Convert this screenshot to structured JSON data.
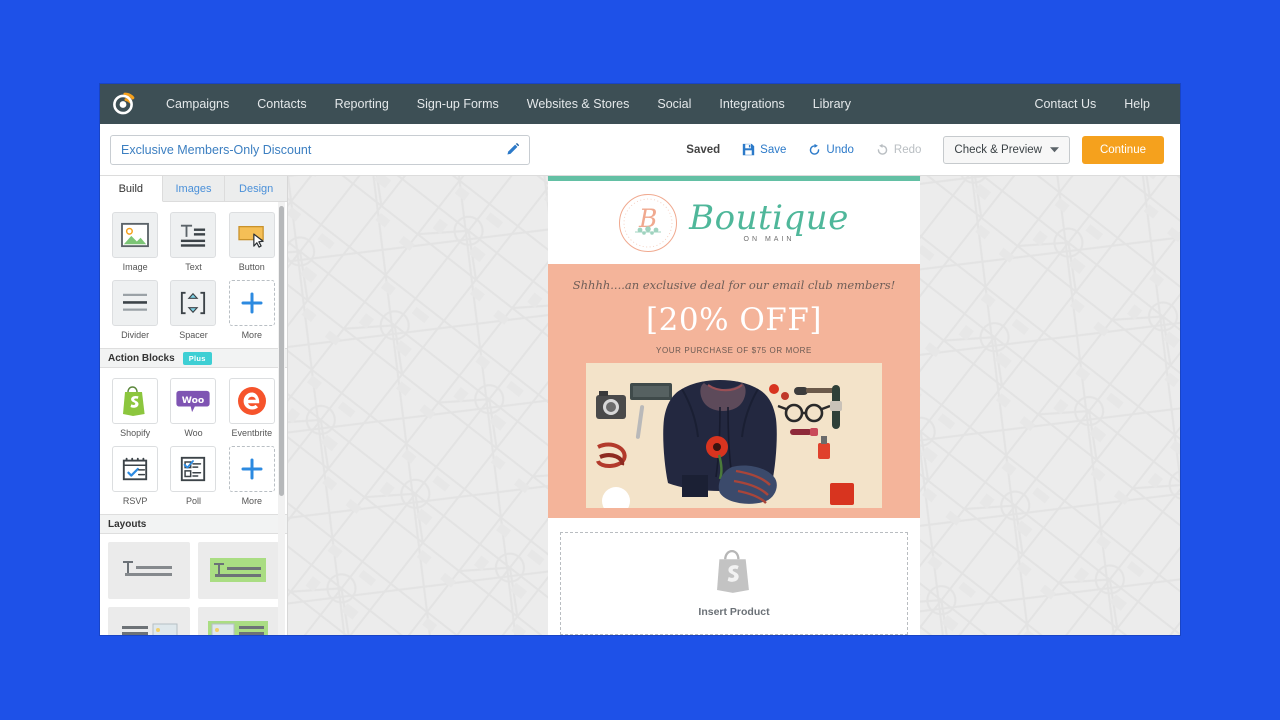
{
  "page": {
    "background_color": "#1e51e8",
    "app_bg": "#ffffff"
  },
  "top_nav": {
    "brand_icon": "constant-contact-logo-icon",
    "brand_colors": {
      "ring": "#ffffff",
      "swoosh": "#f5a11d"
    },
    "background": "#3d4f55",
    "links": [
      {
        "label": "Campaigns"
      },
      {
        "label": "Contacts"
      },
      {
        "label": "Reporting"
      },
      {
        "label": "Sign-up Forms"
      },
      {
        "label": "Websites & Stores"
      },
      {
        "label": "Social"
      },
      {
        "label": "Integrations"
      },
      {
        "label": "Library"
      }
    ],
    "right_links": [
      {
        "label": "Contact Us"
      },
      {
        "label": "Help"
      }
    ]
  },
  "toolbar": {
    "campaign_title": "Exclusive Members-Only Discount",
    "campaign_title_placeholder": "Email name",
    "edit_icon": "pencil-icon",
    "status": "Saved",
    "save_label": "Save",
    "undo_label": "Undo",
    "redo_label": "Redo",
    "check_preview_label": "Check & Preview",
    "continue_label": "Continue",
    "accent_color": "#f5a11d",
    "link_color": "#2c7ac9"
  },
  "sidebar": {
    "tabs": [
      {
        "label": "Build",
        "active": true
      },
      {
        "label": "Images",
        "active": false
      },
      {
        "label": "Design",
        "active": false
      }
    ],
    "build_blocks": [
      {
        "label": "Image",
        "icon": "image-icon"
      },
      {
        "label": "Text",
        "icon": "text-icon"
      },
      {
        "label": "Button",
        "icon": "button-icon"
      },
      {
        "label": "Divider",
        "icon": "divider-icon"
      },
      {
        "label": "Spacer",
        "icon": "spacer-icon"
      },
      {
        "label": "More",
        "icon": "plus-icon"
      }
    ],
    "action_blocks_section": {
      "title": "Action Blocks",
      "badge": "Plus",
      "badge_color": "#3ecfd4"
    },
    "action_blocks": [
      {
        "label": "Shopify",
        "icon": "shopify-icon"
      },
      {
        "label": "Woo",
        "icon": "woocommerce-icon"
      },
      {
        "label": "Eventbrite",
        "icon": "eventbrite-icon"
      },
      {
        "label": "RSVP",
        "icon": "rsvp-calendar-icon"
      },
      {
        "label": "Poll",
        "icon": "poll-icon"
      },
      {
        "label": "More",
        "icon": "plus-icon"
      }
    ],
    "layouts_section": {
      "title": "Layouts"
    },
    "layouts": [
      {
        "name": "text-layout-plain"
      },
      {
        "name": "text-layout-highlighted"
      },
      {
        "name": "text-image-layout-plain"
      },
      {
        "name": "text-image-layout-highlighted"
      }
    ]
  },
  "email": {
    "accent_bar_color": "#63c0a4",
    "promo_bg_color": "#f4b49a",
    "logo": {
      "monogram": "B",
      "wordmark": "Boutique",
      "tagline": "ON MAIN"
    },
    "promo": {
      "teaser": "Shhhh....an exclusive deal for our email club members!",
      "headline": "[20% OFF]",
      "subline": "YOUR PURCHASE OF $75 OR MORE"
    },
    "photo": {
      "alt": "flat-lay of navy coat with camera, glasses, belt and cosmetics on cream background"
    },
    "insert_product": {
      "icon": "shopify-bag-icon",
      "label": "Insert Product"
    },
    "coupon": {
      "icon": "scissors-icon"
    }
  }
}
